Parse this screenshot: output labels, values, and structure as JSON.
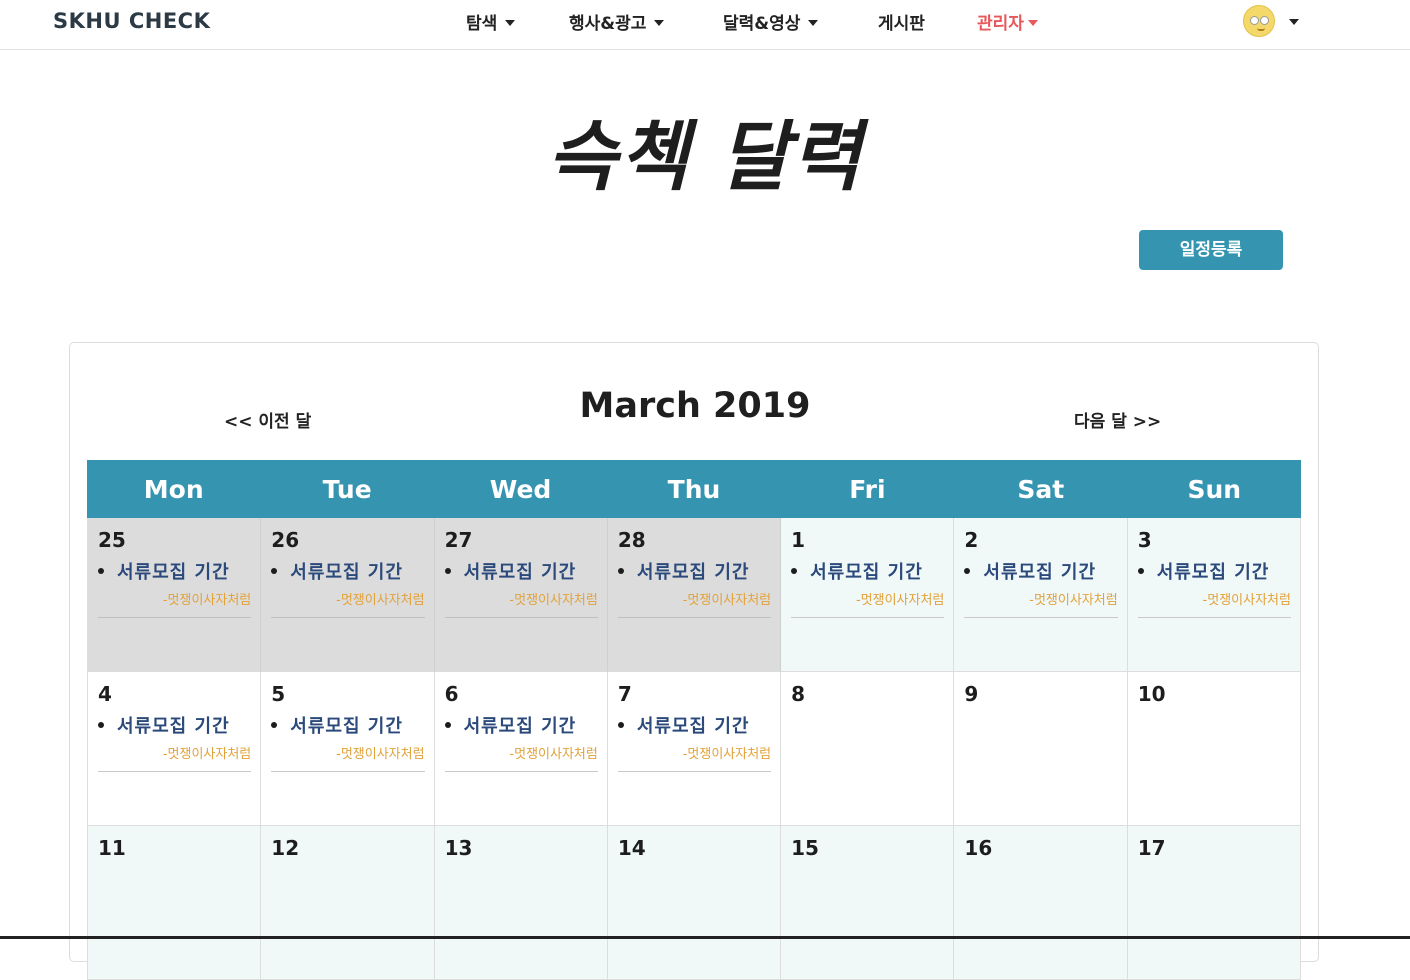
{
  "navbar": {
    "brand": "SKHU CHECK",
    "items": [
      {
        "label": "탐색"
      },
      {
        "label": "행사&광고"
      },
      {
        "label": "달력&영상"
      },
      {
        "label": "게시판"
      },
      {
        "label": "관리자"
      }
    ],
    "accent_color": "#e8575a"
  },
  "page_title": "슥첵 달력",
  "register_button": "일정등록",
  "calendar": {
    "month_title": "March 2019",
    "prev_label": "<< 이전 달",
    "next_label": "다음 달 >>",
    "header_color": "#3595b1",
    "weekdays": [
      "Mon",
      "Tue",
      "Wed",
      "Thu",
      "Fri",
      "Sat",
      "Sun"
    ],
    "weeks": [
      [
        {
          "day": "25",
          "event": "서류모집 기간",
          "sub": "-멋쟁이사자처럼"
        },
        {
          "day": "26",
          "event": "서류모집 기간",
          "sub": "-멋쟁이사자처럼"
        },
        {
          "day": "27",
          "event": "서류모집 기간",
          "sub": "-멋쟁이사자처럼"
        },
        {
          "day": "28",
          "event": "서류모집 기간",
          "sub": "-멋쟁이사자처럼"
        },
        {
          "day": "1",
          "event": "서류모집 기간",
          "sub": "-멋쟁이사자처럼"
        },
        {
          "day": "2",
          "event": "서류모집 기간",
          "sub": "-멋쟁이사자처럼"
        },
        {
          "day": "3",
          "event": "서류모집 기간",
          "sub": "-멋쟁이사자처럼"
        }
      ],
      [
        {
          "day": "4",
          "event": "서류모집 기간",
          "sub": "-멋쟁이사자처럼"
        },
        {
          "day": "5",
          "event": "서류모집 기간",
          "sub": "-멋쟁이사자처럼"
        },
        {
          "day": "6",
          "event": "서류모집 기간",
          "sub": "-멋쟁이사자처럼"
        },
        {
          "day": "7",
          "event": "서류모집 기간",
          "sub": "-멋쟁이사자처럼"
        },
        {
          "day": "8"
        },
        {
          "day": "9"
        },
        {
          "day": "10"
        }
      ],
      [
        {
          "day": "11"
        },
        {
          "day": "12"
        },
        {
          "day": "13"
        },
        {
          "day": "14"
        },
        {
          "day": "15"
        },
        {
          "day": "16"
        },
        {
          "day": "17"
        }
      ]
    ]
  }
}
